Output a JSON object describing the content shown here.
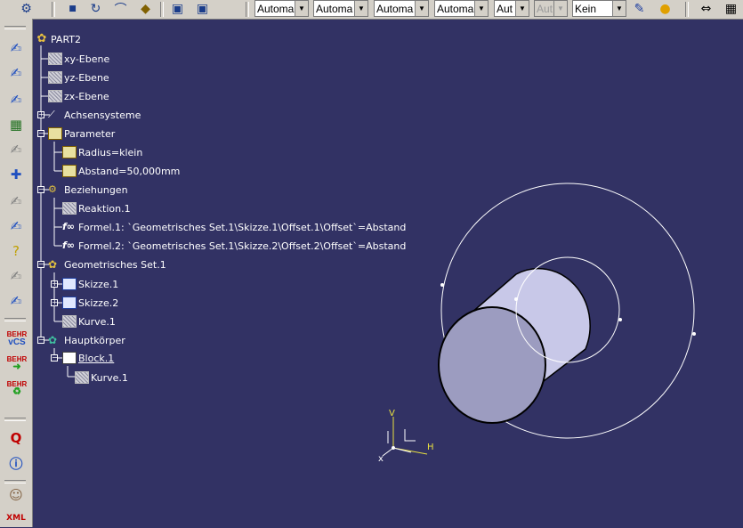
{
  "toolbar": {
    "combos": [
      {
        "value": "Automa",
        "disabled": false
      },
      {
        "value": "Automa",
        "disabled": false
      },
      {
        "value": "Automa",
        "disabled": false
      },
      {
        "value": "Automa",
        "disabled": false
      },
      {
        "value": "Aut",
        "disabled": false
      },
      {
        "value": "Aut",
        "disabled": true
      },
      {
        "value": "Kein",
        "disabled": false
      }
    ]
  },
  "left_toolbar": {
    "behr_label": "BEHR",
    "behr_sub": "vCS"
  },
  "tree": {
    "root": "PART2",
    "xy": "xy-Ebene",
    "yz": "yz-Ebene",
    "zx": "zx-Ebene",
    "axes": "Achsensysteme",
    "parameter": "Parameter",
    "radius": "Radius=klein",
    "abstand": "Abstand=50,000mm",
    "relations": "Beziehungen",
    "reaction": "Reaktion.1",
    "formula1": "Formel.1: `Geometrisches Set.1\\Skizze.1\\Offset.1\\Offset`=Abstand",
    "formula2": "Formel.2: `Geometrisches Set.1\\Skizze.2\\Offset.2\\Offset`=Abstand",
    "geoset": "Geometrisches Set.1",
    "sketch1": "Skizze.1",
    "sketch2": "Skizze.2",
    "curve1": "Kurve.1",
    "body": "Hauptkörper",
    "block": "Block.1",
    "block_curve": "Kurve.1"
  },
  "compass": {
    "v": "V",
    "h": "H",
    "x": "x"
  },
  "colors": {
    "background": "#323264",
    "toolbar": "#d4d0c8",
    "cylinder_side": "#c8c8e8",
    "cylinder_face": "#9c9cc0"
  }
}
